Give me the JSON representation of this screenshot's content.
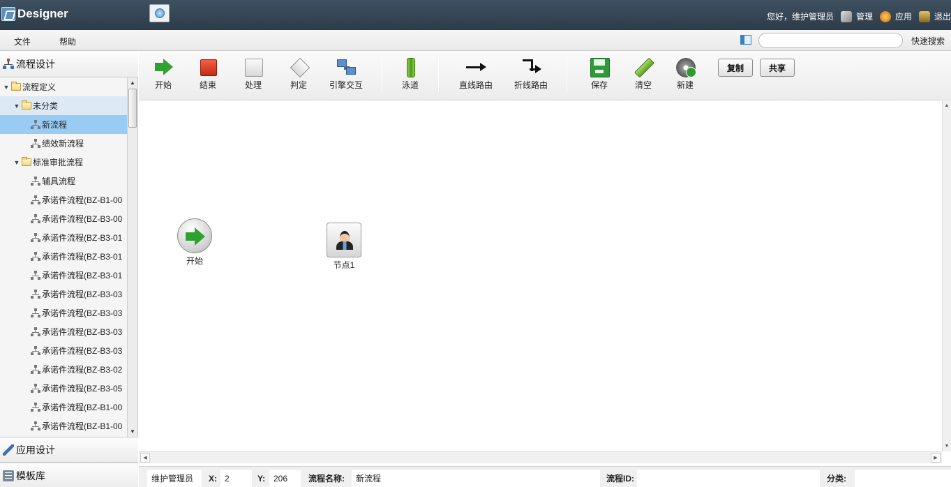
{
  "header": {
    "app_title": "Designer",
    "greeting": "您好，维护管理员",
    "links": [
      {
        "label": "管理",
        "icon": "tools-icon"
      },
      {
        "label": "应用",
        "icon": "app-icon"
      },
      {
        "label": "退出",
        "icon": "exit-icon"
      }
    ]
  },
  "menubar": {
    "items": [
      "文件",
      "帮助"
    ],
    "search": {
      "value": "",
      "placeholder": ""
    },
    "quick_search_label": "快速搜索"
  },
  "left_panel": {
    "sections": [
      {
        "label": "流程设计",
        "icon": "flow-design-icon"
      },
      {
        "label": "应用设计",
        "icon": "brush-icon"
      },
      {
        "label": "模板库",
        "icon": "template-icon"
      }
    ],
    "tree": [
      {
        "label": "流程定义",
        "type": "folder",
        "level": 0,
        "expanded": true
      },
      {
        "label": "未分类",
        "type": "folder",
        "level": 1,
        "expanded": true
      },
      {
        "label": "新流程",
        "type": "process",
        "level": 2,
        "selected": true
      },
      {
        "label": "绩效新流程",
        "type": "process",
        "level": 2
      },
      {
        "label": "标准审批流程",
        "type": "folder",
        "level": 1,
        "expanded": true
      },
      {
        "label": "辅具流程",
        "type": "process",
        "level": 2
      },
      {
        "label": "承诺件流程(BZ-B1-00",
        "type": "process",
        "level": 2
      },
      {
        "label": "承诺件流程(BZ-B3-00",
        "type": "process",
        "level": 2
      },
      {
        "label": "承诺件流程(BZ-B3-01",
        "type": "process",
        "level": 2
      },
      {
        "label": "承诺件流程(BZ-B3-01",
        "type": "process",
        "level": 2
      },
      {
        "label": "承诺件流程(BZ-B3-01",
        "type": "process",
        "level": 2
      },
      {
        "label": "承诺件流程(BZ-B3-03",
        "type": "process",
        "level": 2
      },
      {
        "label": "承诺件流程(BZ-B3-03",
        "type": "process",
        "level": 2
      },
      {
        "label": "承诺件流程(BZ-B3-03",
        "type": "process",
        "level": 2
      },
      {
        "label": "承诺件流程(BZ-B3-03",
        "type": "process",
        "level": 2
      },
      {
        "label": "承诺件流程(BZ-B3-02",
        "type": "process",
        "level": 2
      },
      {
        "label": "承诺件流程(BZ-B3-05",
        "type": "process",
        "level": 2
      },
      {
        "label": "承诺件流程(BZ-B1-00",
        "type": "process",
        "level": 2
      },
      {
        "label": "承诺件流程(BZ-B1-00",
        "type": "process",
        "level": 2
      }
    ]
  },
  "toolbar": {
    "tools": [
      {
        "label": "开始",
        "icon": "start-arrow-icon"
      },
      {
        "label": "结束",
        "icon": "end-square-icon"
      },
      {
        "label": "处理",
        "icon": "process-square-icon"
      },
      {
        "label": "判定",
        "icon": "decision-diamond-icon"
      },
      {
        "label": "引擎交互",
        "icon": "engine-interaction-icon"
      },
      {
        "label": "泳道",
        "icon": "swimlane-icon"
      },
      {
        "label": "直线路由",
        "icon": "straight-route-icon"
      },
      {
        "label": "折线路由",
        "icon": "polyline-route-icon"
      },
      {
        "label": "保存",
        "icon": "save-icon"
      },
      {
        "label": "清空",
        "icon": "clear-icon"
      },
      {
        "label": "新建",
        "icon": "new-gear-icon"
      }
    ],
    "buttons": {
      "copy": "复制",
      "share": "共享"
    }
  },
  "canvas": {
    "nodes": [
      {
        "label": "开始",
        "icon": "start-node-icon"
      },
      {
        "label": "节点1",
        "icon": "user-node-icon"
      }
    ]
  },
  "statusbar": {
    "user": "维护管理员",
    "x_label": "X:",
    "x_value": "2",
    "y_label": "Y:",
    "y_value": "206",
    "name_label": "流程名称:",
    "name_value": "新流程",
    "id_label": "流程ID:",
    "id_value": "",
    "category_label": "分类:",
    "category_value": ""
  }
}
